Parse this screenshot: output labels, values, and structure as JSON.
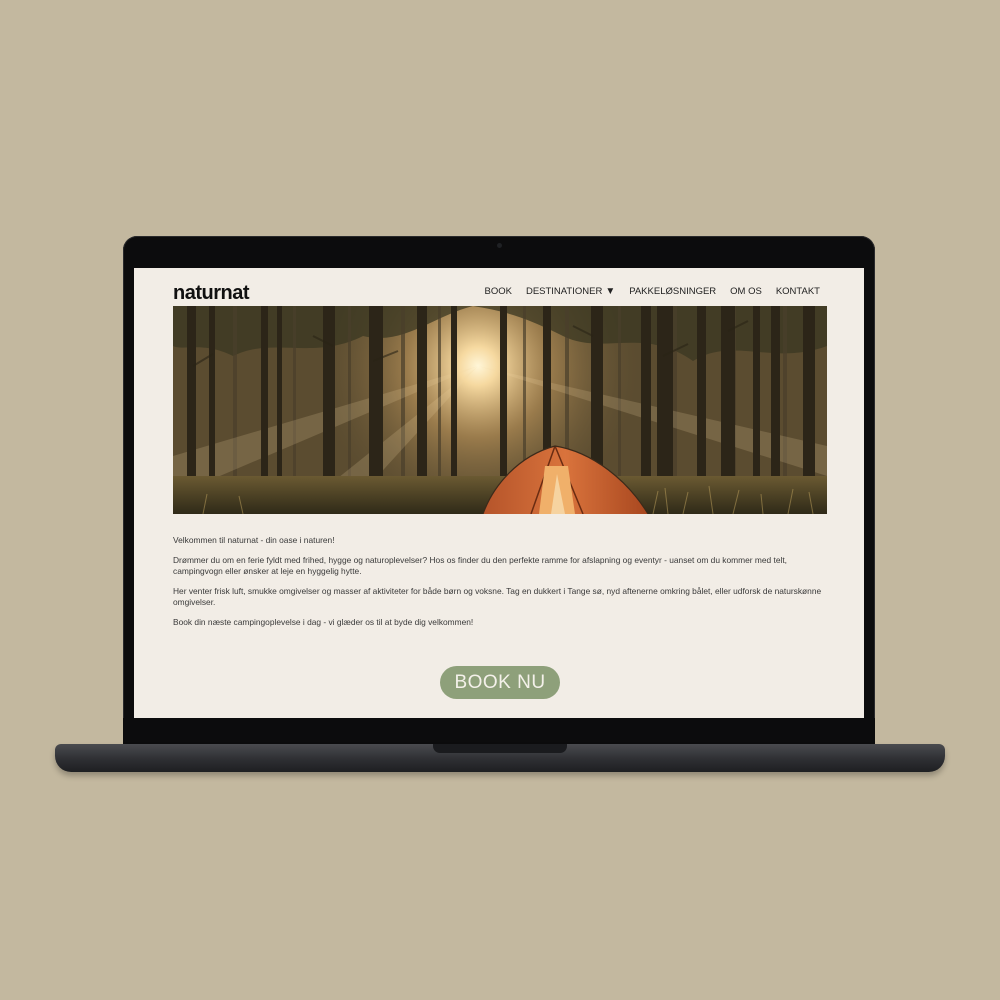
{
  "site": {
    "logo": "naturnat"
  },
  "nav": [
    {
      "label": "BOOK"
    },
    {
      "label": "DESTINATIONER",
      "caret": "▼"
    },
    {
      "label": "PAKKELØSNINGER"
    },
    {
      "label": "OM OS"
    },
    {
      "label": "KONTAKT"
    }
  ],
  "hero": {
    "description": "forest-tent-sunlight"
  },
  "content": {
    "p1": "Velkommen til naturnat - din oase i naturen!",
    "p2": "Drømmer du om en ferie fyldt med frihed, hygge og naturoplevelser? Hos os finder du den perfekte ramme for afslapning og eventyr - uanset om du kommer med telt, campingvogn eller ønsker at leje en hyggelig hytte.",
    "p3": "Her venter frisk luft, smukke omgivelser og masser af aktiviteter for både børn og voksne. Tag en dukkert i Tange sø, nyd aftenerne omkring bålet, eller udforsk de naturskønne omgivelser.",
    "p4": "Book din næste campingoplevelse i dag - vi glæder os til at byde dig velkommen!"
  },
  "cta": {
    "label": "BOOK NU"
  },
  "colors": {
    "background": "#c3b89f",
    "screen": "#f2ede6",
    "button": "#8ea07a"
  }
}
